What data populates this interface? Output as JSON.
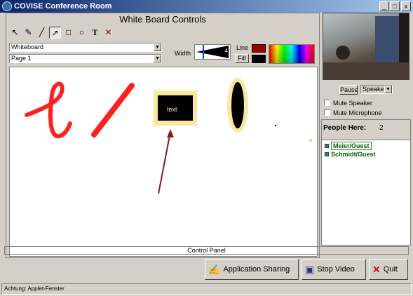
{
  "window": {
    "title": "COVISE Conference Room",
    "minimize_glyph": "_",
    "maximize_glyph": "□",
    "close_glyph": "x"
  },
  "whiteboard": {
    "header": "White Board Controls",
    "tools": [
      {
        "icon": "select-arrow-icon",
        "glyph": "↖"
      },
      {
        "icon": "pen-icon",
        "glyph": "✎"
      },
      {
        "icon": "line-icon",
        "glyph": "╱"
      },
      {
        "icon": "arrow-icon",
        "glyph": "↗"
      },
      {
        "icon": "rectangle-icon",
        "glyph": "□"
      },
      {
        "icon": "ellipse-icon",
        "glyph": "○"
      },
      {
        "icon": "text-icon",
        "glyph": "T"
      },
      {
        "icon": "erase-icon",
        "glyph": "✕"
      }
    ],
    "board_select": "Whiteboard",
    "page_select": "Page 1",
    "width_label": "Width",
    "width_value": "4",
    "line_label": "Line",
    "fill_label": "Fill",
    "line_color": "#a00000",
    "fill_color": "#000000",
    "canvas": {
      "text_box_label": "text",
      "stroke_color": "#ff2020",
      "arrow_color": "#8b1a1a",
      "highlight_color": "#fbe7a0"
    }
  },
  "video": {
    "pause_label": "Pause",
    "speaker_select": "Speaker",
    "mute_speaker_label": "Mute Speaker",
    "mute_microphone_label": "Mute Microphone"
  },
  "people": {
    "header": "People Here:",
    "count": "2",
    "list": [
      {
        "name": "Meier/Guest",
        "selected": true
      },
      {
        "name": "Schmidt/Guest",
        "selected": false
      }
    ]
  },
  "control_panel_label": "Control Panel",
  "actions": {
    "app_sharing_label": "Application Sharing",
    "stop_video_label": "Stop Video",
    "quit_label": "Quit"
  },
  "status": {
    "text": "Achtung: Applet-Fenster"
  }
}
